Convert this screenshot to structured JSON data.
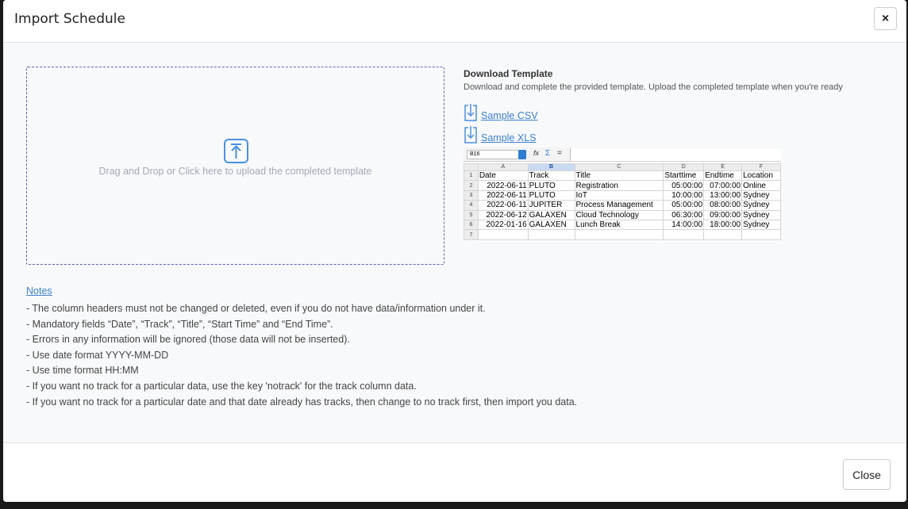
{
  "modal": {
    "title": "Import Schedule",
    "close_icon": "×",
    "close_button_label": "Close"
  },
  "upload": {
    "icon": "upload-icon",
    "text": "Drag and Drop or Click here to upload the completed template"
  },
  "download": {
    "title": "Download Template",
    "subtitle": "Download and complete the provided template. Upload the completed template when you're ready",
    "links": [
      {
        "label": "Sample CSV",
        "icon": "download-icon"
      },
      {
        "label": "Sample XLS",
        "icon": "download-icon"
      }
    ]
  },
  "sheet": {
    "cell_ref": "B16",
    "formula_symbols": {
      "fx": "fx",
      "sigma": "Σ",
      "equals": "="
    },
    "column_letters": [
      "A",
      "B",
      "C",
      "D",
      "E",
      "F"
    ],
    "selected_column": "B",
    "row_numbers": [
      "1",
      "2",
      "3",
      "4",
      "5",
      "6",
      "7"
    ],
    "rows": [
      [
        "Date",
        "Track",
        "Title",
        "Starttime",
        "Endtime",
        "Location"
      ],
      [
        "2022-06-11",
        "PLUTO",
        "Registration",
        "05:00:00",
        "07:00:00",
        "Online"
      ],
      [
        "2022-06-11",
        "PLUTO",
        "IoT",
        "10:00:00",
        "13:00:00",
        "Sydney"
      ],
      [
        "2022-06-11",
        "JUPITER",
        "Process Management",
        "05:00:00",
        "08:00:00",
        "Sydney"
      ],
      [
        "2022-06-12",
        "GALAXEN",
        "Cloud Technology",
        "06:30:00",
        "09:00:00",
        "Sydney"
      ],
      [
        "2022-01-16",
        "GALAXEN",
        "Lunch Break",
        "14:00:00",
        "18:00:00",
        "Sydney"
      ],
      [
        "",
        "",
        "",
        "",
        "",
        ""
      ]
    ]
  },
  "notes": {
    "title": "Notes",
    "items": [
      "- The column headers must not be changed or deleted, even if you do not have data/information under it.",
      "- Mandatory fields “Date”, “Track”, “Title”, “Start Time” and “End Time”.",
      "- Errors in any information will be ignored (those data will not be inserted).",
      "- Use date format YYYY-MM-DD",
      "- Use time format HH:MM",
      "- If you want no track for a particular data, use the key 'notrack' for the track column data.",
      "- If you want no track for a particular date and that date already has tracks, then change to no track first, then import you data."
    ]
  },
  "colors": {
    "accent": "#3b7fd0",
    "dropzone_border": "#5a63c9"
  }
}
